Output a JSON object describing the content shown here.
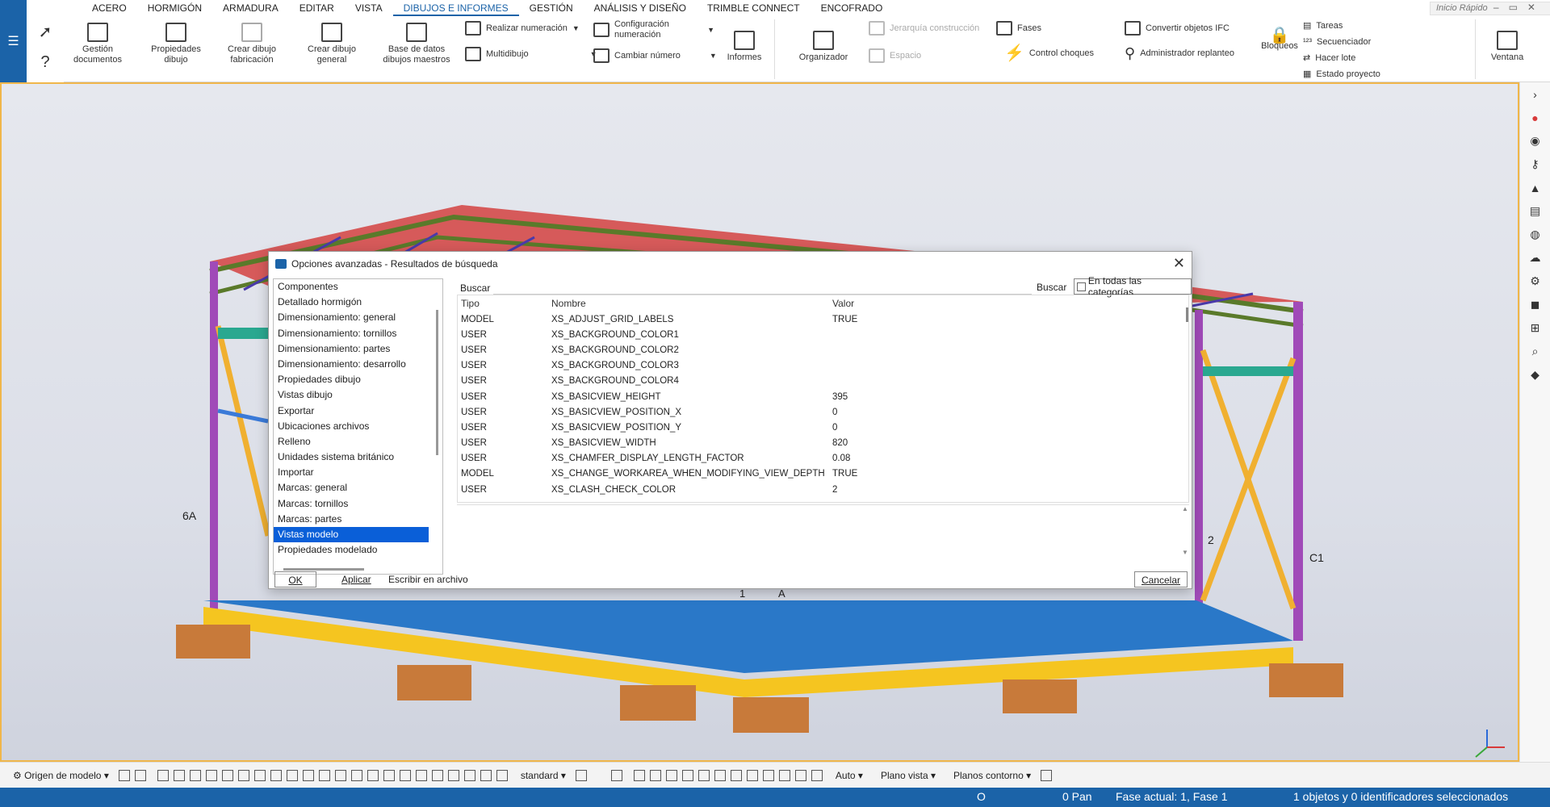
{
  "title_tabs": [
    "ACERO",
    "HORMIGÓN",
    "ARMADURA",
    "EDITAR",
    "VISTA",
    "DIBUJOS E INFORMES",
    "GESTIÓN",
    "ANÁLISIS Y DISEÑO",
    "TRIMBLE CONNECT",
    "ENCOFRADO"
  ],
  "active_tab": "DIBUJOS E INFORMES",
  "quick_search": {
    "placeholder": "Inicio Rápido"
  },
  "ribbon": {
    "gestion_documentos": "Gestión documentos",
    "propiedades_dibujo": "Propiedades dibujo",
    "crear_dibujo_fabricacion": "Crear dibujo fabricación",
    "crear_dibujo_general": "Crear dibujo general",
    "base_datos": "Base de datos dibujos maestros",
    "realizar_numeracion": "Realizar numeración",
    "multidibujo": "Multidibujo",
    "configuracion_numeracion": "Configuración numeración",
    "cambiar_numero": "Cambiar número",
    "informes": "Informes",
    "organizador": "Organizador",
    "jerarquia": "Jerarquía construcción",
    "espacio": "Espacio",
    "fases": "Fases",
    "control_choques": "Control choques",
    "convertir_ifc": "Convertir objetos IFC",
    "administrador_replanteo": "Administrador replanteo",
    "bloqueos": "Bloqueos",
    "tareas": "Tareas",
    "secuenciador": "Secuenciador",
    "hacer_lote": "Hacer lote",
    "estado_proyecto": "Estado proyecto",
    "ventana": "Ventana"
  },
  "dialog": {
    "title": "Opciones avanzadas - Resultados de búsqueda",
    "categories": [
      "Componentes",
      "Detallado hormigón",
      "Dimensionamiento: general",
      "Dimensionamiento: tornillos",
      "Dimensionamiento: partes",
      "Dimensionamiento: desarrollo",
      "Propiedades dibujo",
      "Vistas dibujo",
      "Exportar",
      "Ubicaciones archivos",
      "Relleno",
      "Unidades sistema británico",
      "Importar",
      "Marcas: general",
      "Marcas: tornillos",
      "Marcas: partes",
      "Vistas modelo",
      "Propiedades modelado"
    ],
    "selected_category": "Vistas modelo",
    "search_label": "Buscar",
    "search_value": "",
    "search_button": "Buscar",
    "all_categories": "En todas las categorías",
    "columns": [
      "Tipo",
      "Nombre",
      "Valor"
    ],
    "rows": [
      [
        "MODEL",
        "XS_ADJUST_GRID_LABELS",
        "TRUE"
      ],
      [
        "USER",
        "XS_BACKGROUND_COLOR1",
        ""
      ],
      [
        "USER",
        "XS_BACKGROUND_COLOR2",
        ""
      ],
      [
        "USER",
        "XS_BACKGROUND_COLOR3",
        ""
      ],
      [
        "USER",
        "XS_BACKGROUND_COLOR4",
        ""
      ],
      [
        "USER",
        "XS_BASICVIEW_HEIGHT",
        "395"
      ],
      [
        "USER",
        "XS_BASICVIEW_POSITION_X",
        "0"
      ],
      [
        "USER",
        "XS_BASICVIEW_POSITION_Y",
        "0"
      ],
      [
        "USER",
        "XS_BASICVIEW_WIDTH",
        "820"
      ],
      [
        "USER",
        "XS_CHAMFER_DISPLAY_LENGTH_FACTOR",
        "0.08"
      ],
      [
        "MODEL",
        "XS_CHANGE_WORKAREA_WHEN_MODIFYING_VIEW_DEPTH",
        "TRUE"
      ],
      [
        "USER",
        "XS_CLASH_CHECK_COLOR",
        "2"
      ]
    ],
    "ok": "OK",
    "apply": "Aplicar",
    "write_file": "Escribir en archivo",
    "cancel": "Cancelar"
  },
  "viewport_labels": {
    "left_grid": "6A",
    "right_grid_num": "2",
    "right_grid": "C1",
    "center_grid": "1",
    "center_grid_b": "A"
  },
  "bottom_toolbar": {
    "origin": "Origen de modelo",
    "standard": "standard",
    "auto": "Auto",
    "plano_vista": "Plano vista",
    "planos_contorno": "Planos contorno"
  },
  "status": {
    "o": "O",
    "pan": "0 Pan",
    "fase": "Fase actual: 1, Fase 1",
    "selected": "1 objetos y 0 identificadores seleccionados"
  },
  "colors": {
    "accent": "#1b63a8",
    "selection": "#0a5fd8",
    "viewport_border": "#f0b64a"
  }
}
